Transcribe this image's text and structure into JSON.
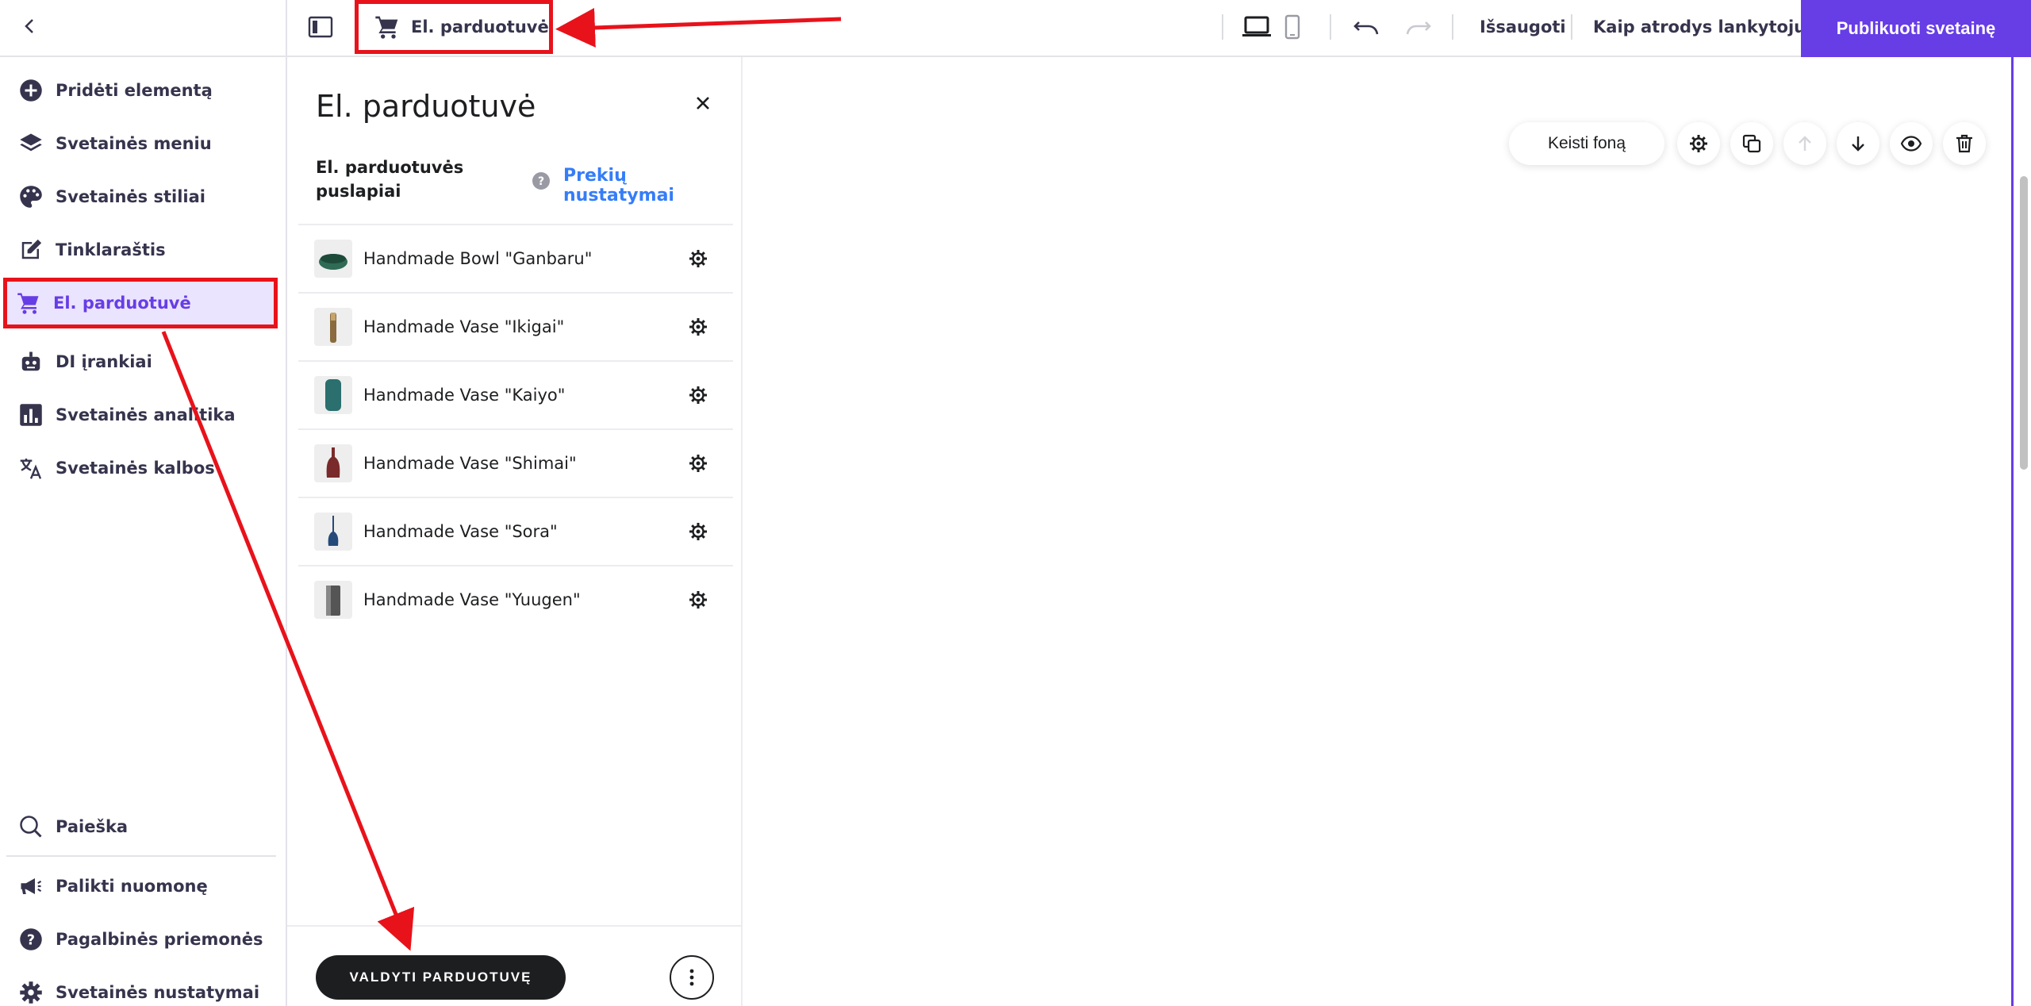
{
  "topbar": {
    "store_label": "El. parduotuvė",
    "saved_label": "Išsaugoti",
    "preview_label": "Kaip atrodys lankytojui",
    "publish_label": "Publikuoti svetainę"
  },
  "sidebar": {
    "items": [
      {
        "label": "Pridėti elementą",
        "icon": "plus-circle-icon"
      },
      {
        "label": "Svetainės meniu",
        "icon": "layers-icon"
      },
      {
        "label": "Svetainės stiliai",
        "icon": "palette-icon"
      },
      {
        "label": "Tinklaraštis",
        "icon": "edit-icon"
      },
      {
        "label": "El. parduotuvė",
        "icon": "cart-icon"
      },
      {
        "label": "DI įrankiai",
        "icon": "robot-icon"
      },
      {
        "label": "Svetainės analitika",
        "icon": "analytics-icon"
      },
      {
        "label": "Svetainės kalbos",
        "icon": "translate-icon"
      }
    ],
    "bottom_items": [
      {
        "label": "Paieška",
        "icon": "search-icon"
      },
      {
        "label": "Palikti nuomonę",
        "icon": "megaphone-icon"
      },
      {
        "label": "Pagalbinės priemonės",
        "icon": "help-icon"
      },
      {
        "label": "Svetainės nustatymai",
        "icon": "gear-icon"
      }
    ]
  },
  "panel": {
    "title": "El. parduotuvė",
    "subtitle": "El. parduotuvės puslapiai",
    "settings_link": "Prekių nustatymai",
    "products": [
      {
        "name": "Handmade Bowl \"Ganbaru\"",
        "color": "#2f6b55"
      },
      {
        "name": "Handmade Vase \"Ikigai\"",
        "color": "#8a6a3e"
      },
      {
        "name": "Handmade Vase \"Kaiyo\"",
        "color": "#2b6f6f"
      },
      {
        "name": "Handmade Vase \"Shimai\"",
        "color": "#7a2a2a"
      },
      {
        "name": "Handmade Vase \"Sora\"",
        "color": "#244a7a"
      },
      {
        "name": "Handmade Vase \"Yuugen\"",
        "color": "#555555"
      }
    ],
    "manage_label": "VALDYTI PARDUOTUVĘ"
  },
  "canvas": {
    "bg_button_label": "Keisti foną"
  },
  "colors": {
    "accent": "#673de6",
    "link": "#357df9",
    "annotation": "#e8121b"
  }
}
